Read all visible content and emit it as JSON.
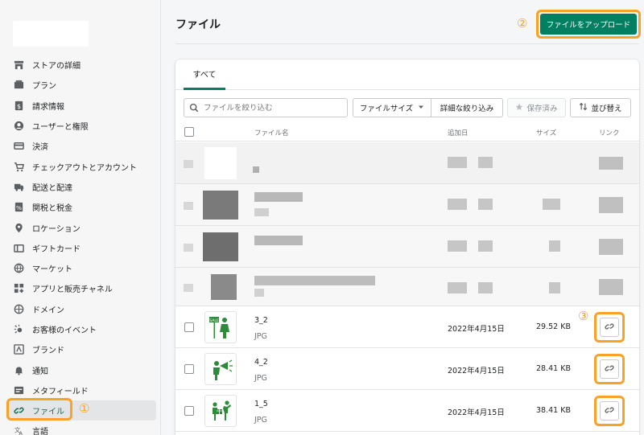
{
  "page": {
    "title": "ファイル",
    "upload_label": "ファイルをアップロード"
  },
  "sidebar": {
    "items": [
      {
        "label": "ストアの詳細",
        "icon": "store-icon"
      },
      {
        "label": "プラン",
        "icon": "plan-icon"
      },
      {
        "label": "請求情報",
        "icon": "billing-icon"
      },
      {
        "label": "ユーザーと権限",
        "icon": "user-icon"
      },
      {
        "label": "決済",
        "icon": "payment-icon"
      },
      {
        "label": "チェックアウトとアカウント",
        "icon": "cart-icon"
      },
      {
        "label": "配送と配達",
        "icon": "truck-icon"
      },
      {
        "label": "関税と税金",
        "icon": "tax-icon"
      },
      {
        "label": "ロケーション",
        "icon": "location-icon"
      },
      {
        "label": "ギフトカード",
        "icon": "gift-card-icon"
      },
      {
        "label": "マーケット",
        "icon": "globe-icon"
      },
      {
        "label": "アプリと販売チャネル",
        "icon": "apps-icon"
      },
      {
        "label": "ドメイン",
        "icon": "domain-icon"
      },
      {
        "label": "お客様のイベント",
        "icon": "events-icon"
      },
      {
        "label": "ブランド",
        "icon": "brand-icon"
      },
      {
        "label": "通知",
        "icon": "bell-icon"
      },
      {
        "label": "メタフィールド",
        "icon": "metafield-icon"
      },
      {
        "label": "ファイル",
        "icon": "link-icon"
      },
      {
        "label": "言語",
        "icon": "language-icon"
      }
    ]
  },
  "annotations": {
    "one": "①",
    "two": "②",
    "three": "③"
  },
  "tabs": {
    "all": "すべて"
  },
  "toolbar": {
    "search_placeholder": "ファイルを絞り込む",
    "file_size": "ファイルサイズ",
    "detail_filter": "詳細な絞り込み",
    "saved": "保存済み",
    "sort": "並び替え"
  },
  "table": {
    "headers": {
      "name": "ファイル名",
      "date": "追加日",
      "size": "サイズ",
      "link": "リンク"
    },
    "rows": [
      {
        "name": "3_2",
        "type": "JPG",
        "date": "2022年4月15日",
        "size": "29.52 KB"
      },
      {
        "name": "4_2",
        "type": "JPG",
        "date": "2022年4月15日",
        "size": "28.41 KB"
      },
      {
        "name": "1_5",
        "type": "JPG",
        "date": "2022年4月15日",
        "size": "38.41 KB"
      }
    ]
  },
  "colors": {
    "accent": "#008060",
    "highlight": "#f7a32a",
    "pictogram": "#2e8b3a"
  }
}
